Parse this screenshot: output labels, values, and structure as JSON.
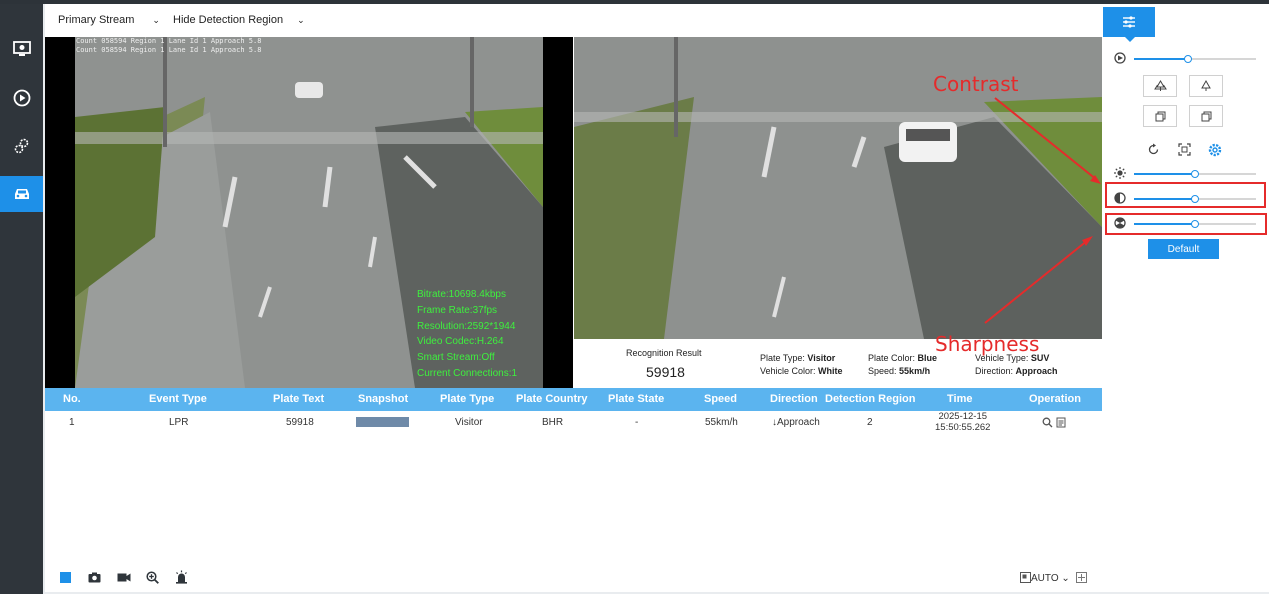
{
  "toolbar": {
    "stream_label": "Primary Stream",
    "detection_label": "Hide Detection Region"
  },
  "video": {
    "osd_line1": "Count 058594 Region 1 Lane Id 1 Approach 5.8",
    "osd_line2": "Count 058594 Region 1 Lane Id 1 Approach 5.8",
    "stats": [
      "Bitrate:10698.4kbps",
      "Frame Rate:37fps",
      "Resolution:2592*1944",
      "Video Codec:H.264",
      "Smart Stream:Off",
      "Current Connections:1"
    ]
  },
  "recognition": {
    "title": "Recognition Result",
    "plate": "59918",
    "plate_type_label": "Plate Type:",
    "plate_type": "Visitor",
    "plate_color_label": "Plate Color:",
    "plate_color": "Blue",
    "vehicle_type_label": "Vehicle Type:",
    "vehicle_type": "SUV",
    "vehicle_color_label": "Vehicle Color:",
    "vehicle_color": "White",
    "speed_label": "Speed:",
    "speed": "55km/h",
    "direction_label": "Direction:",
    "direction": "Approach"
  },
  "table": {
    "headers": [
      "No.",
      "Event Type",
      "Plate Text",
      "Snapshot",
      "Plate Type",
      "Plate Country",
      "Plate State",
      "Speed",
      "Direction",
      "Detection Region",
      "Time",
      "Operation"
    ],
    "rows": [
      {
        "no": "1",
        "event": "LPR",
        "plate": "59918",
        "plate_type": "Visitor",
        "country": "BHR",
        "state": "-",
        "speed": "55km/h",
        "direction": "Approach",
        "region": "2",
        "date": "2025-12-15",
        "time": "15:50:55.262"
      }
    ]
  },
  "bottom": {
    "auto_label": "AUTO"
  },
  "panel": {
    "default_label": "Default"
  },
  "annotations": {
    "contrast": "Contrast",
    "sharpness": "Sharpness"
  },
  "colors": {
    "accent": "#1e90e8",
    "annotation": "#e52b2b",
    "sidebar": "#2f353b",
    "osd_green": "#3ef03e"
  }
}
